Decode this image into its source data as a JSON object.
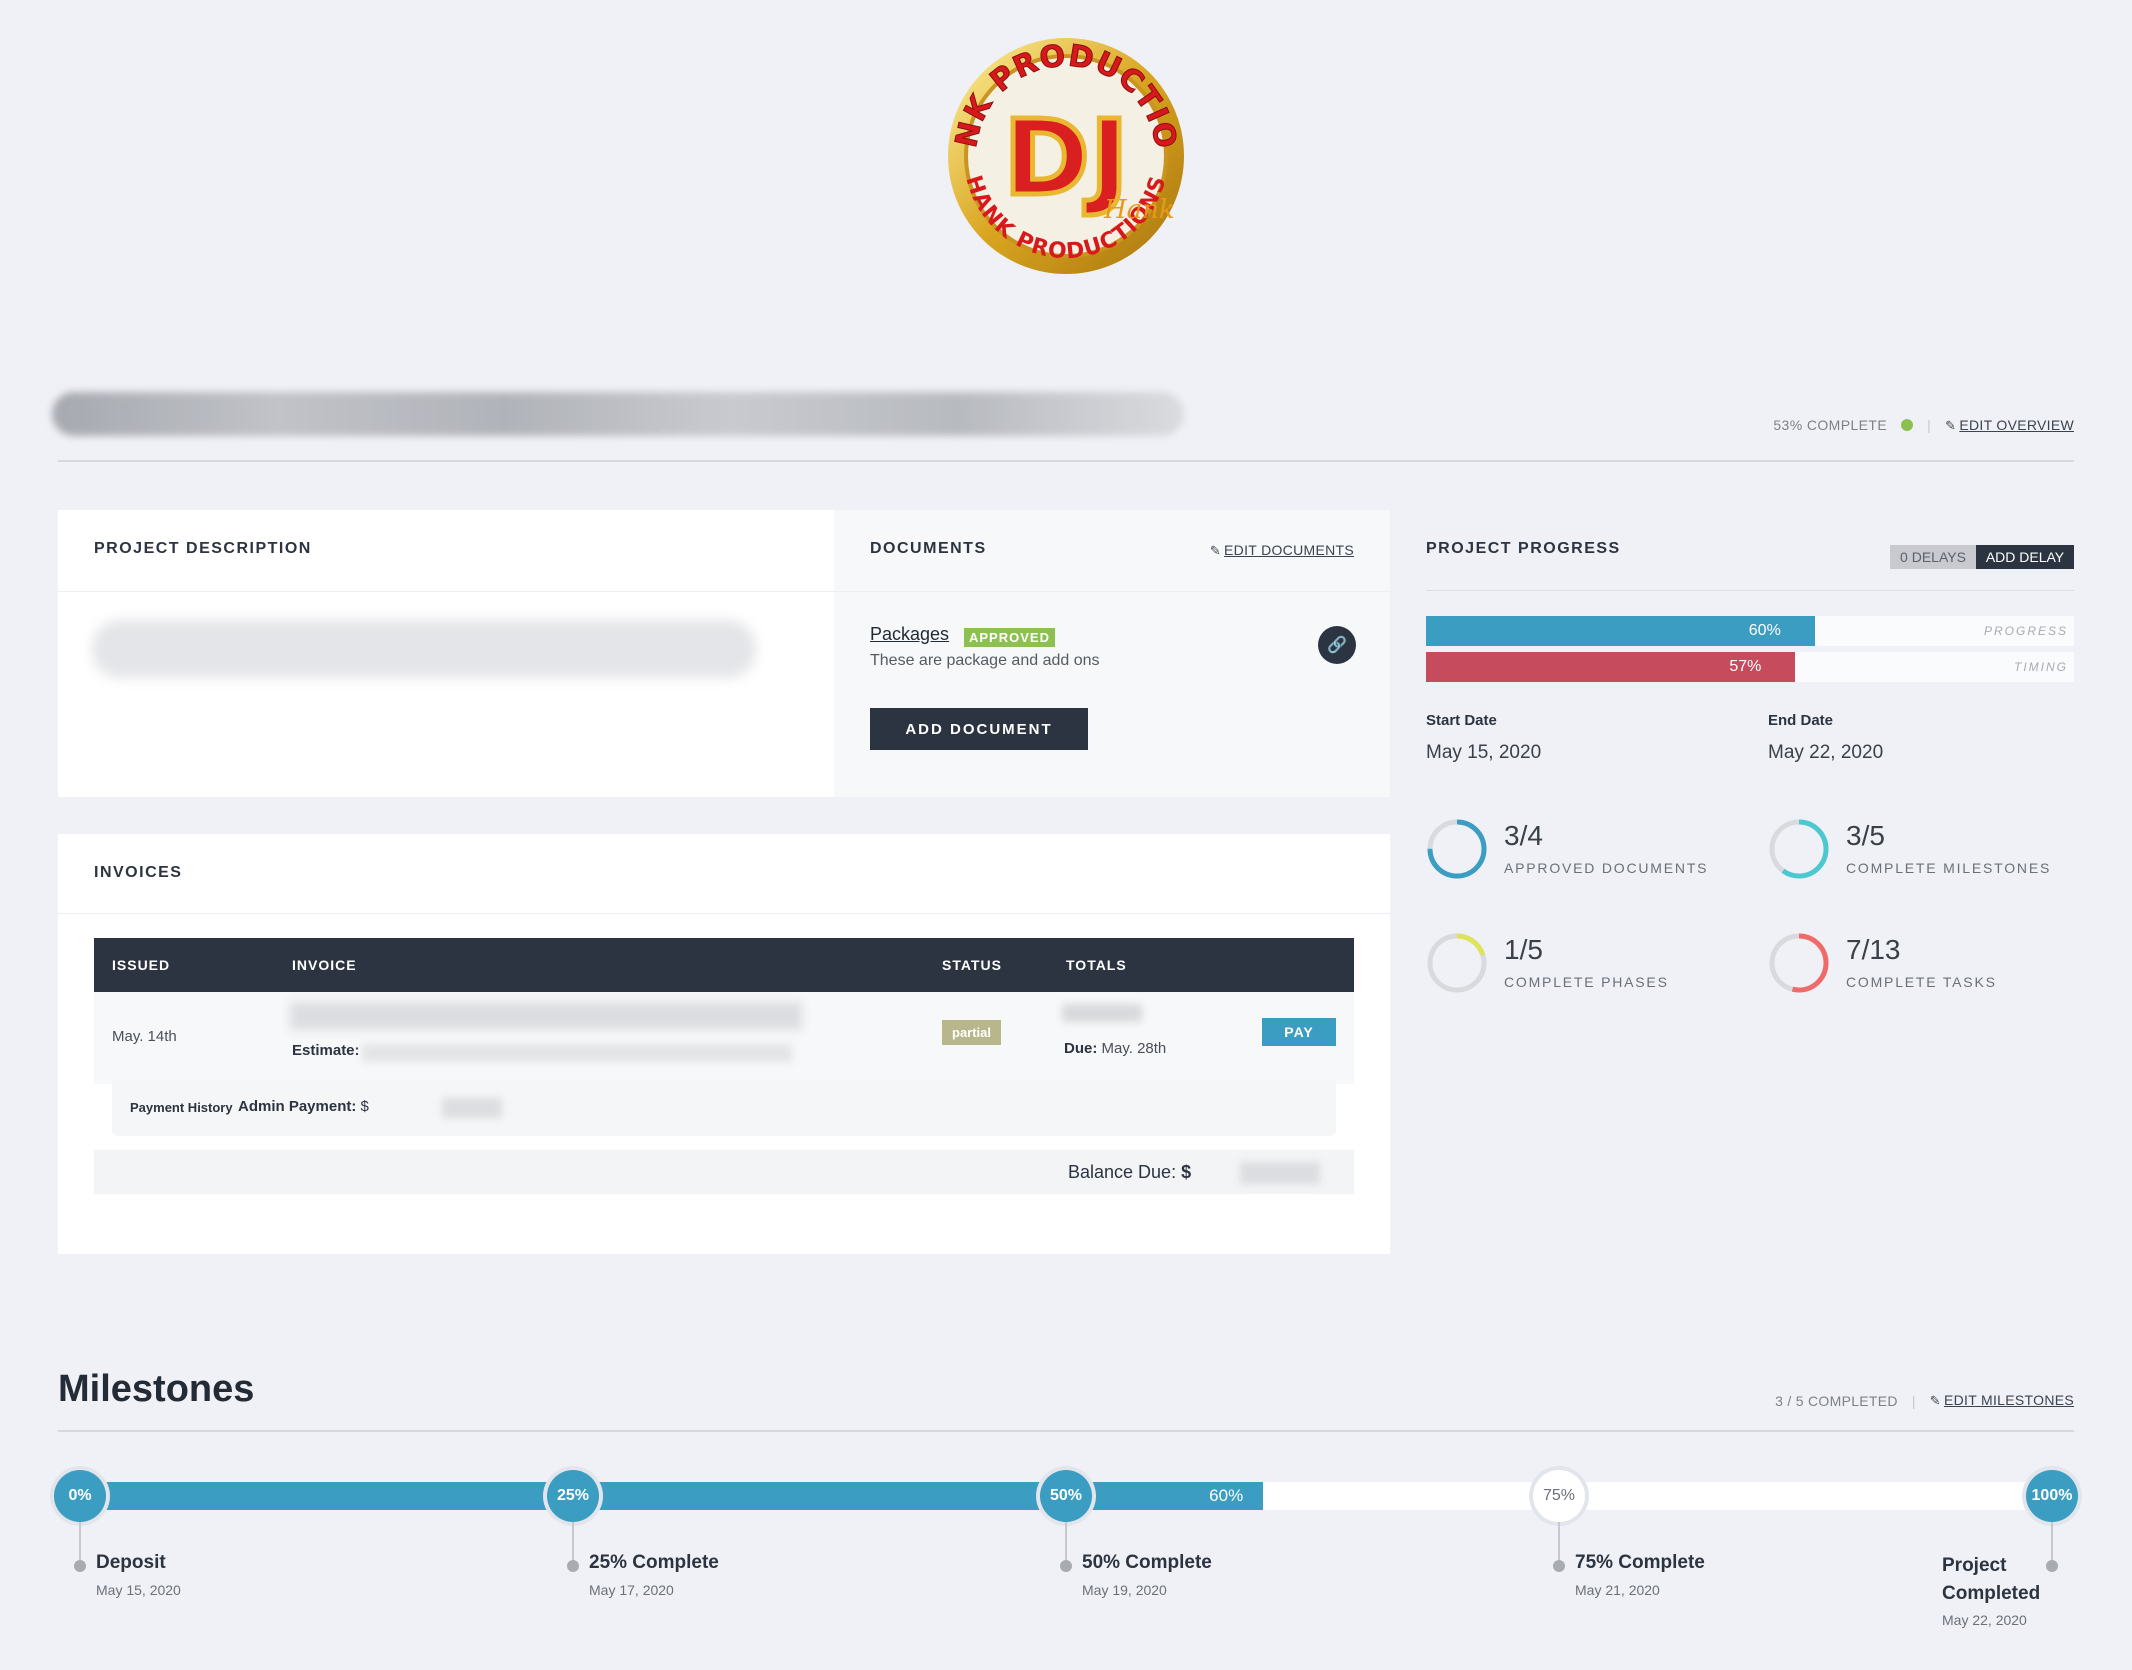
{
  "logo": {
    "arc_text": "HANK PRODUCTIONS",
    "center_text": "DJ",
    "script_text": "Hank"
  },
  "header": {
    "completion": "53% COMPLETE",
    "edit_overview": "EDIT OVERVIEW",
    "status_color": "#8cc152"
  },
  "description": {
    "title": "PROJECT DESCRIPTION"
  },
  "documents": {
    "title": "DOCUMENTS",
    "edit_label": "EDIT DOCUMENTS",
    "items": [
      {
        "name": "Packages",
        "badge": "APPROVED",
        "description": "These are package and add ons",
        "link_icon": "link-icon"
      }
    ],
    "add_button": "ADD DOCUMENT"
  },
  "invoices": {
    "title": "INVOICES",
    "columns": [
      "ISSUED",
      "INVOICE",
      "STATUS",
      "TOTALS"
    ],
    "rows": [
      {
        "issued": "May. 14th",
        "estimate_label": "Estimate:",
        "status": "partial",
        "due_label": "Due:",
        "due_date": "May. 28th",
        "action": "PAY"
      }
    ],
    "payment_history": {
      "label": "Payment History",
      "entry_label": "Admin Payment:",
      "currency": "$"
    },
    "balance_label": "Balance Due:",
    "balance_currency": "$"
  },
  "progress": {
    "title": "PROJECT PROGRESS",
    "delays": "0 DELAYS",
    "add_delay": "ADD DELAY",
    "bars": [
      {
        "label": "PROGRESS",
        "value": 60,
        "display": "60%",
        "color": "#3a9dc1"
      },
      {
        "label": "TIMING",
        "value": 57,
        "display": "57%",
        "color": "#c64b5c"
      }
    ],
    "start_label": "Start Date",
    "start_date": "May 15, 2020",
    "end_label": "End Date",
    "end_date": "May 22, 2020",
    "stats": [
      {
        "value": "3/4",
        "label": "APPROVED DOCUMENTS",
        "fraction": 0.75,
        "color": "#3a9dc1"
      },
      {
        "value": "3/5",
        "label": "COMPLETE MILESTONES",
        "fraction": 0.6,
        "color": "#4cc8d0"
      },
      {
        "value": "1/5",
        "label": "COMPLETE PHASES",
        "fraction": 0.2,
        "color": "#dde35a"
      },
      {
        "value": "7/13",
        "label": "COMPLETE TASKS",
        "fraction": 0.538,
        "color": "#f06a6a"
      }
    ]
  },
  "milestones": {
    "title": "Milestones",
    "completed": "3 / 5 COMPLETED",
    "edit_label": "EDIT MILESTONES",
    "progress": 60,
    "progress_display": "60%",
    "items": [
      {
        "percent": "0%",
        "name": "Deposit",
        "date": "May 15, 2020",
        "done": true
      },
      {
        "percent": "25%",
        "name": "25% Complete",
        "date": "May 17, 2020",
        "done": true
      },
      {
        "percent": "50%",
        "name": "50% Complete",
        "date": "May 19, 2020",
        "done": true
      },
      {
        "percent": "75%",
        "name": "75% Complete",
        "date": "May 21, 2020",
        "done": false
      },
      {
        "percent": "100%",
        "name": "Project Completed",
        "date": "May 22, 2020",
        "done": true
      }
    ]
  }
}
